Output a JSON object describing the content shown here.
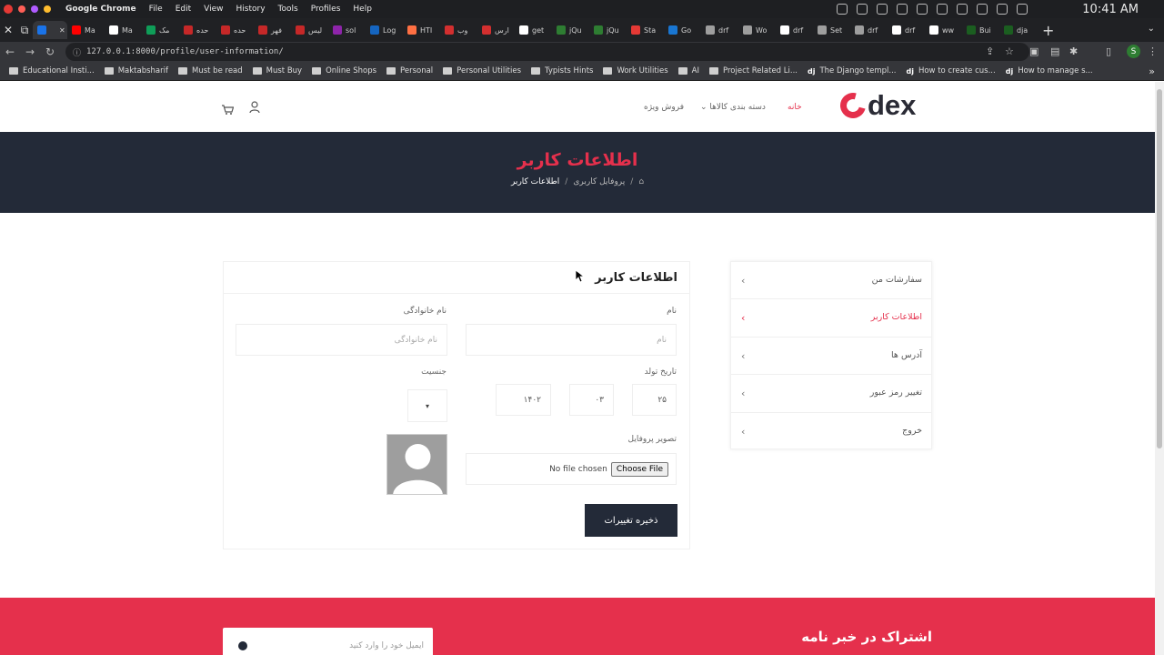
{
  "menubar": {
    "app": "Google Chrome",
    "menus": [
      "File",
      "Edit",
      "View",
      "History",
      "Tools",
      "Profiles",
      "Help"
    ],
    "clock": "10:41 AM"
  },
  "tabs": [
    {
      "label": "",
      "color": "#1a73e8",
      "active": true
    },
    {
      "label": "Ma",
      "color": "#ff0000"
    },
    {
      "label": "Ma",
      "color": "#ffffff"
    },
    {
      "label": "مک",
      "color": "#0f9d58"
    },
    {
      "label": "حده",
      "color": "#c62828"
    },
    {
      "label": "حده",
      "color": "#c62828"
    },
    {
      "label": "فهر",
      "color": "#c62828"
    },
    {
      "label": "لیس",
      "color": "#c62828"
    },
    {
      "label": "sol",
      "color": "#8e24aa"
    },
    {
      "label": "Log",
      "color": "#1565c0"
    },
    {
      "label": "HTI",
      "color": "#ff7043"
    },
    {
      "label": "وب",
      "color": "#d32f2f"
    },
    {
      "label": "ارس",
      "color": "#d32f2f"
    },
    {
      "label": "get",
      "color": "#ffffff"
    },
    {
      "label": "jQu",
      "color": "#2e7d32"
    },
    {
      "label": "jQu",
      "color": "#2e7d32"
    },
    {
      "label": "Sta",
      "color": "#e53935"
    },
    {
      "label": "Go",
      "color": "#1976d2"
    },
    {
      "label": "drf",
      "color": "#9e9e9e"
    },
    {
      "label": "Wo",
      "color": "#9e9e9e"
    },
    {
      "label": "drf",
      "color": "#ffffff"
    },
    {
      "label": "Set",
      "color": "#9e9e9e"
    },
    {
      "label": "drf",
      "color": "#9e9e9e"
    },
    {
      "label": "drf",
      "color": "#ffffff"
    },
    {
      "label": "ww",
      "color": "#ffffff"
    },
    {
      "label": "Bui",
      "color": "#1b5e20"
    },
    {
      "label": "dja",
      "color": "#1b5e20"
    }
  ],
  "url": "127.0.0.1:8000/profile/user-information/",
  "bookmarks": [
    {
      "label": "Educational Insti...",
      "type": "folder"
    },
    {
      "label": "Maktabsharif",
      "type": "folder"
    },
    {
      "label": "Must be read",
      "type": "folder"
    },
    {
      "label": "Must Buy",
      "type": "folder"
    },
    {
      "label": "Online Shops",
      "type": "folder"
    },
    {
      "label": "Personal",
      "type": "folder"
    },
    {
      "label": "Personal Utilities",
      "type": "folder"
    },
    {
      "label": "Typists Hints",
      "type": "folder"
    },
    {
      "label": "Work Utilities",
      "type": "folder"
    },
    {
      "label": "AI",
      "type": "folder"
    },
    {
      "label": "Project Related Li...",
      "type": "folder"
    },
    {
      "label": "The Django templ...",
      "type": "django"
    },
    {
      "label": "How to create cus...",
      "type": "django"
    },
    {
      "label": "How to manage s...",
      "type": "django"
    }
  ],
  "site": {
    "logo": "dex",
    "nav": {
      "home": "خانه",
      "categories": "دسته بندی کالاها",
      "special": "فروش ویژه"
    },
    "banner_title": "اطلاعات کاربر",
    "breadcrumb": {
      "parent": "پروفایل کاربری",
      "current": "اطلاعات کاربر"
    },
    "sidebar": [
      {
        "label": "سفارشات من",
        "active": false
      },
      {
        "label": "اطلاعات کاربر",
        "active": true
      },
      {
        "label": "آدرس ها",
        "active": false
      },
      {
        "label": "تغییر رمز عبور",
        "active": false
      },
      {
        "label": "خروج",
        "active": false
      }
    ],
    "form": {
      "title": "اطلاعات کاربر",
      "first_name_label": "نام",
      "first_name_placeholder": "نام",
      "last_name_label": "نام خانوادگی",
      "last_name_placeholder": "نام خانوادگی",
      "birthdate_label": "تاریخ تولد",
      "birth_day": "۲۵",
      "birth_month": "۰۳",
      "birth_year": "۱۴۰۲",
      "gender_label": "جنسیت",
      "profile_image_label": "تصویر پروفایل",
      "file_button": "Choose File",
      "file_status": "No file chosen",
      "save_button": "ذخیره تغییرات"
    },
    "newsletter": {
      "title": "اشتراک در خبر نامه",
      "email_placeholder": "ایمیل خود را وارد کنید"
    }
  },
  "colors": {
    "brand": "#e5304c",
    "dark": "#232a38"
  }
}
